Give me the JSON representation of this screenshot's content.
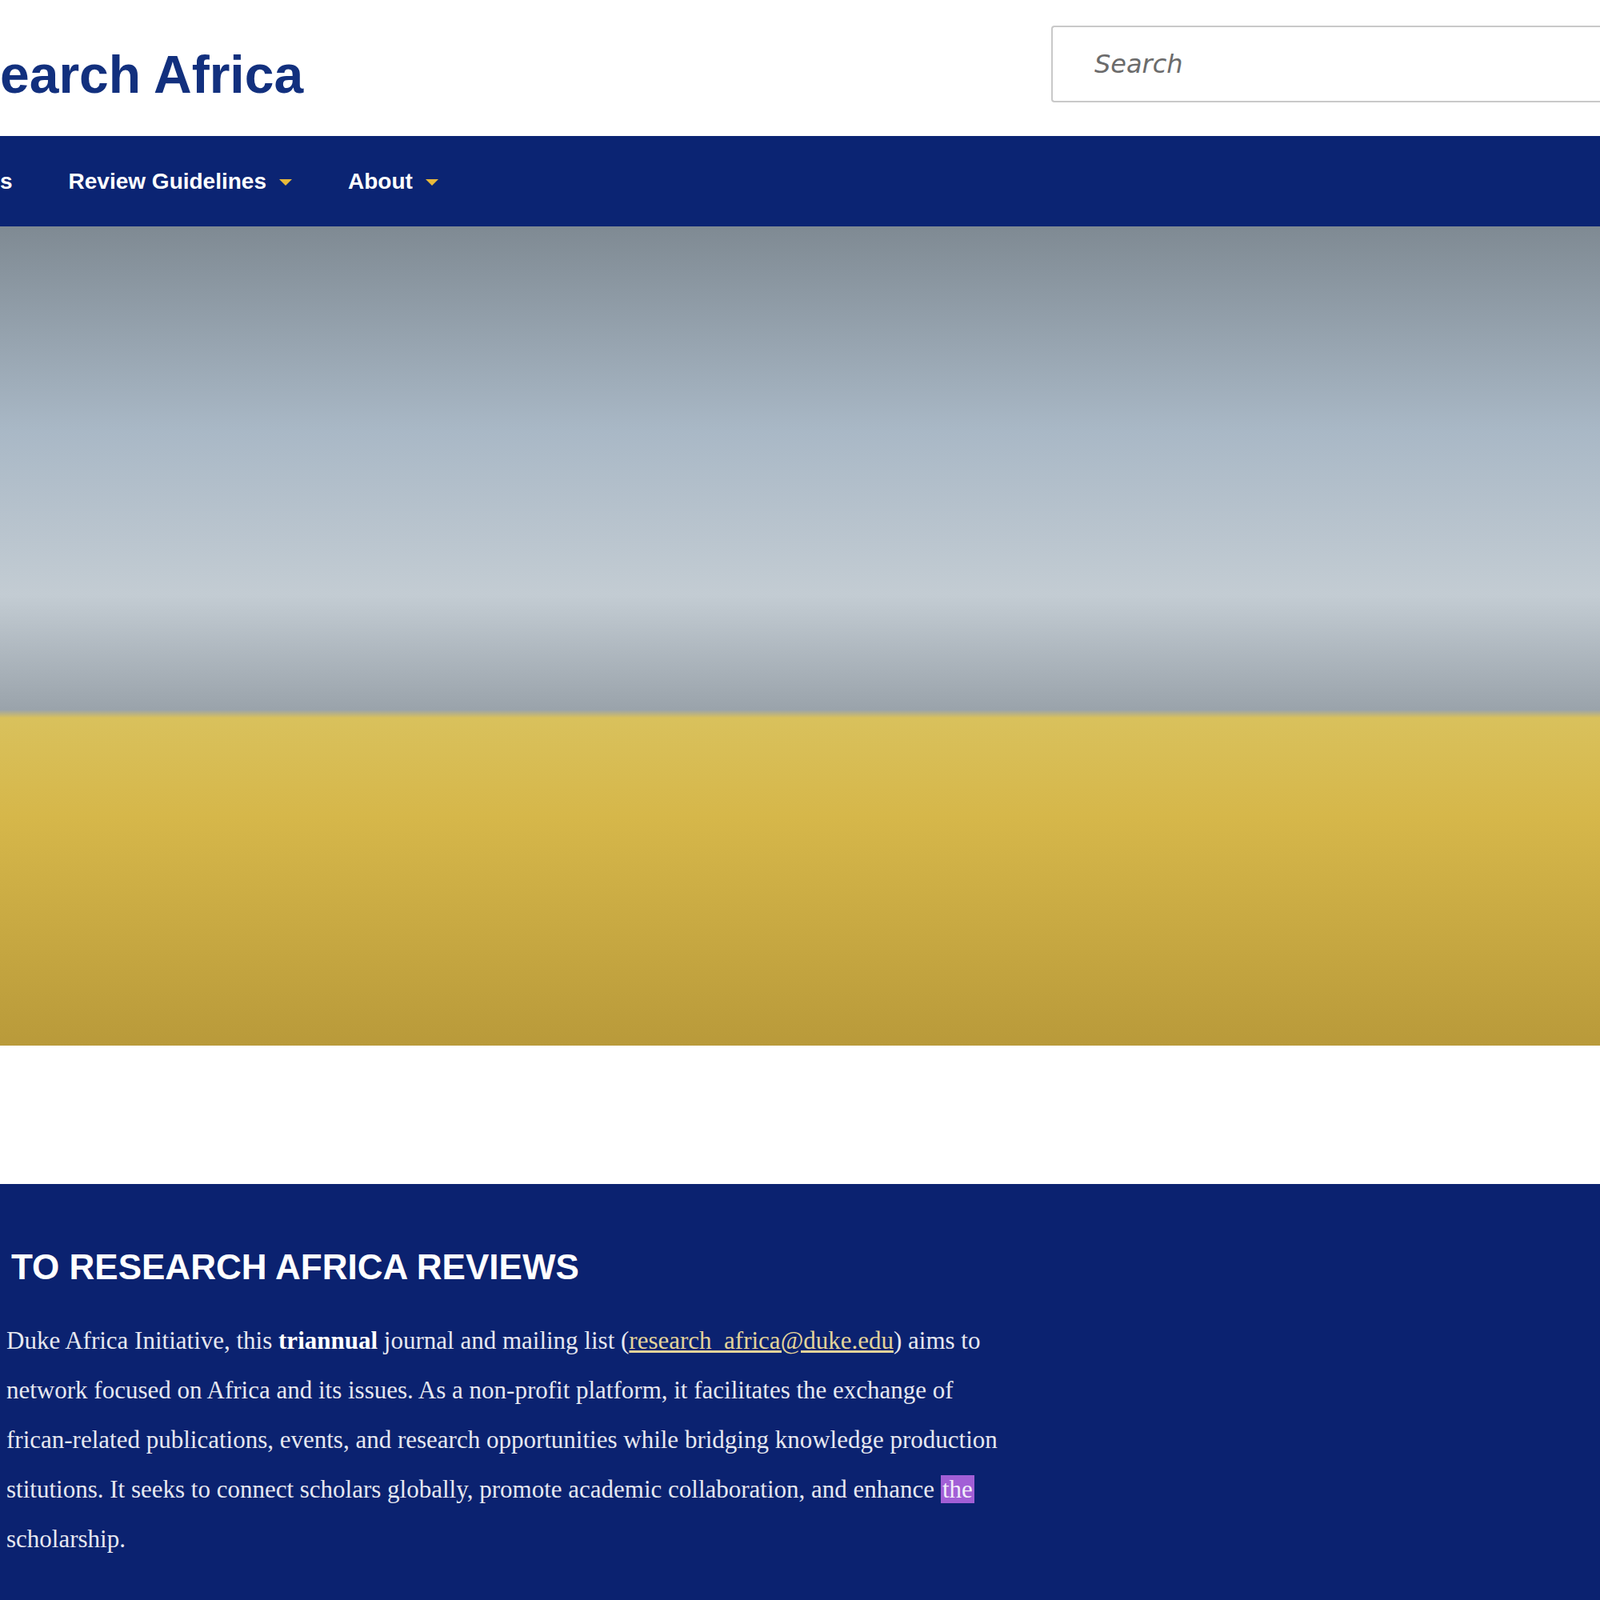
{
  "header": {
    "title": "earch Africa",
    "search": {
      "placeholder": "Search"
    }
  },
  "nav": [
    {
      "label": "s",
      "dropdown": false
    },
    {
      "label": "Review Guidelines",
      "dropdown": true
    },
    {
      "label": "About",
      "dropdown": true
    }
  ],
  "hero": {
    "kind": "photo"
  },
  "intro": {
    "heading": "TO RESEARCH AFRICA REVIEWS",
    "lines": [
      [
        {
          "text": "Duke Africa Initiative, this ",
          "kind": "plain"
        },
        {
          "text": "triannual",
          "kind": "bold"
        },
        {
          "text": " journal and mailing list (",
          "kind": "plain"
        },
        {
          "text": "research_africa@duke.edu",
          "kind": "link"
        },
        {
          "text": ") aims to",
          "kind": "plain"
        }
      ],
      [
        {
          "text": "network focused on Africa and its issues. As a non-profit platform, it facilitates the exchange of",
          "kind": "plain"
        }
      ],
      [
        {
          "text": "frican-related publications, events, and research opportunities while bridging knowledge production",
          "kind": "plain"
        }
      ],
      [
        {
          "text": "stitutions. It seeks to connect scholars globally, promote academic collaboration, and enhance ",
          "kind": "plain"
        },
        {
          "text": "the",
          "kind": "highlight"
        }
      ],
      [
        {
          "text": "scholarship.",
          "kind": "plain"
        }
      ]
    ]
  }
}
